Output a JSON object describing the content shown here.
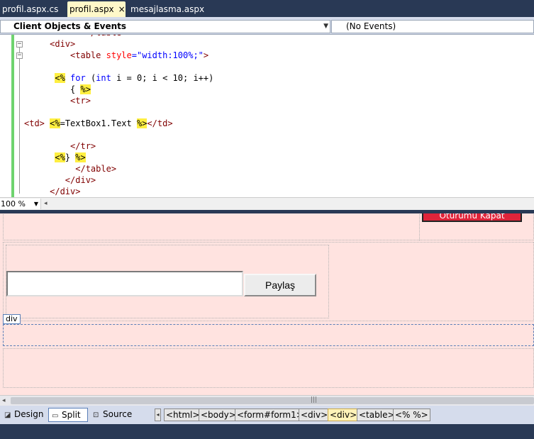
{
  "tabs": [
    {
      "label": "profil.aspx.cs",
      "active": false
    },
    {
      "label": "profil.aspx",
      "active": true
    },
    {
      "label": "mesajlasma.aspx",
      "active": false
    }
  ],
  "tab_close_glyph": "×",
  "dropdowns": {
    "objects": "Client Objects & Events",
    "events": "(No Events)"
  },
  "code_lines": [
    {
      "indent": "            ",
      "parts": [
        {
          "t": "</table>",
          "c": "tag"
        }
      ]
    },
    {
      "indent": "     ",
      "parts": [
        {
          "t": "<div>",
          "c": "tag"
        }
      ]
    },
    {
      "indent": "         ",
      "parts": [
        {
          "t": "<table",
          "c": "tag"
        },
        {
          "t": " style",
          "c": "attr"
        },
        {
          "t": "=",
          "c": "bl"
        },
        {
          "t": "\"width:100%;\"",
          "c": "bl"
        },
        {
          "t": ">",
          "c": "tag"
        }
      ]
    },
    {
      "indent": "",
      "parts": []
    },
    {
      "indent": "      ",
      "parts": [
        {
          "t": "<%",
          "c": "hl"
        },
        {
          "t": " for",
          "c": "bl"
        },
        {
          "t": " (",
          "c": ""
        },
        {
          "t": "int",
          "c": "bl"
        },
        {
          "t": " i = 0; i < 10; i++)",
          "c": ""
        }
      ]
    },
    {
      "indent": "         ",
      "parts": [
        {
          "t": "{ ",
          "c": ""
        },
        {
          "t": "%>",
          "c": "hl"
        }
      ]
    },
    {
      "indent": "         ",
      "parts": [
        {
          "t": "<tr>",
          "c": "tag"
        }
      ]
    },
    {
      "indent": "",
      "parts": []
    },
    {
      "indent": "",
      "parts": [
        {
          "t": "<td>",
          "c": "tag"
        },
        {
          "t": " ",
          "c": ""
        },
        {
          "t": "<%",
          "c": "hl"
        },
        {
          "t": "=TextBox1.Text ",
          "c": ""
        },
        {
          "t": "%>",
          "c": "hl"
        },
        {
          "t": "</td>",
          "c": "tag"
        }
      ]
    },
    {
      "indent": "",
      "parts": []
    },
    {
      "indent": "         ",
      "parts": [
        {
          "t": "</tr>",
          "c": "tag"
        }
      ]
    },
    {
      "indent": "      ",
      "parts": [
        {
          "t": "<%",
          "c": "hl"
        },
        {
          "t": "} ",
          "c": ""
        },
        {
          "t": "%>",
          "c": "hl"
        }
      ]
    },
    {
      "indent": "          ",
      "parts": [
        {
          "t": "</table>",
          "c": "tag"
        }
      ]
    },
    {
      "indent": "        ",
      "parts": [
        {
          "t": "</div>",
          "c": "tag"
        }
      ]
    },
    {
      "indent": "     ",
      "parts": [
        {
          "t": "</div>",
          "c": "tag"
        }
      ]
    }
  ],
  "zoom": "100 %",
  "design": {
    "top_button_label": "Oturumu Kapat",
    "share_button_label": "Paylaş",
    "textbox_value": "",
    "selected_tag": "div"
  },
  "views": [
    {
      "label": "Design",
      "active": false
    },
    {
      "label": "Split",
      "active": true
    },
    {
      "label": "Source",
      "active": false
    }
  ],
  "breadcrumbs": [
    {
      "label": "<html>",
      "selected": false
    },
    {
      "label": "<body>",
      "selected": false
    },
    {
      "label": "<form#form1>",
      "selected": false
    },
    {
      "label": "<div>",
      "selected": false
    },
    {
      "label": "<div>",
      "selected": true
    },
    {
      "label": "<table>",
      "selected": false
    },
    {
      "label": "<% %>",
      "selected": false
    }
  ],
  "colors": {
    "chrome": "#293955",
    "design_bg": "#ffe3e0",
    "highlight": "#ffef41",
    "top_button": "#e0243a"
  }
}
